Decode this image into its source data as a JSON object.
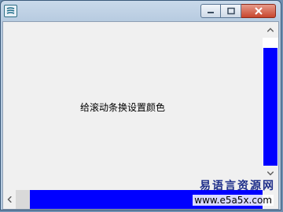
{
  "window": {
    "content_text": "给滚动条换设置颜色",
    "scrollbar_color": "#0000ff",
    "caption_buttons": [
      "minimize",
      "maximize",
      "close"
    ],
    "vertical_scroll_level": 0.1,
    "horizontal_scroll_level": 0
  },
  "watermark": {
    "brand": "易语言资源网",
    "url": "www.e5a5x.com"
  },
  "icons": {
    "app": "app-icon",
    "minimize": "minimize-icon",
    "maximize": "maximize-icon",
    "close": "close-icon",
    "up": "chevron-up-icon",
    "down": "chevron-down-icon",
    "left": "chevron-left-icon",
    "right": "chevron-right-icon"
  }
}
